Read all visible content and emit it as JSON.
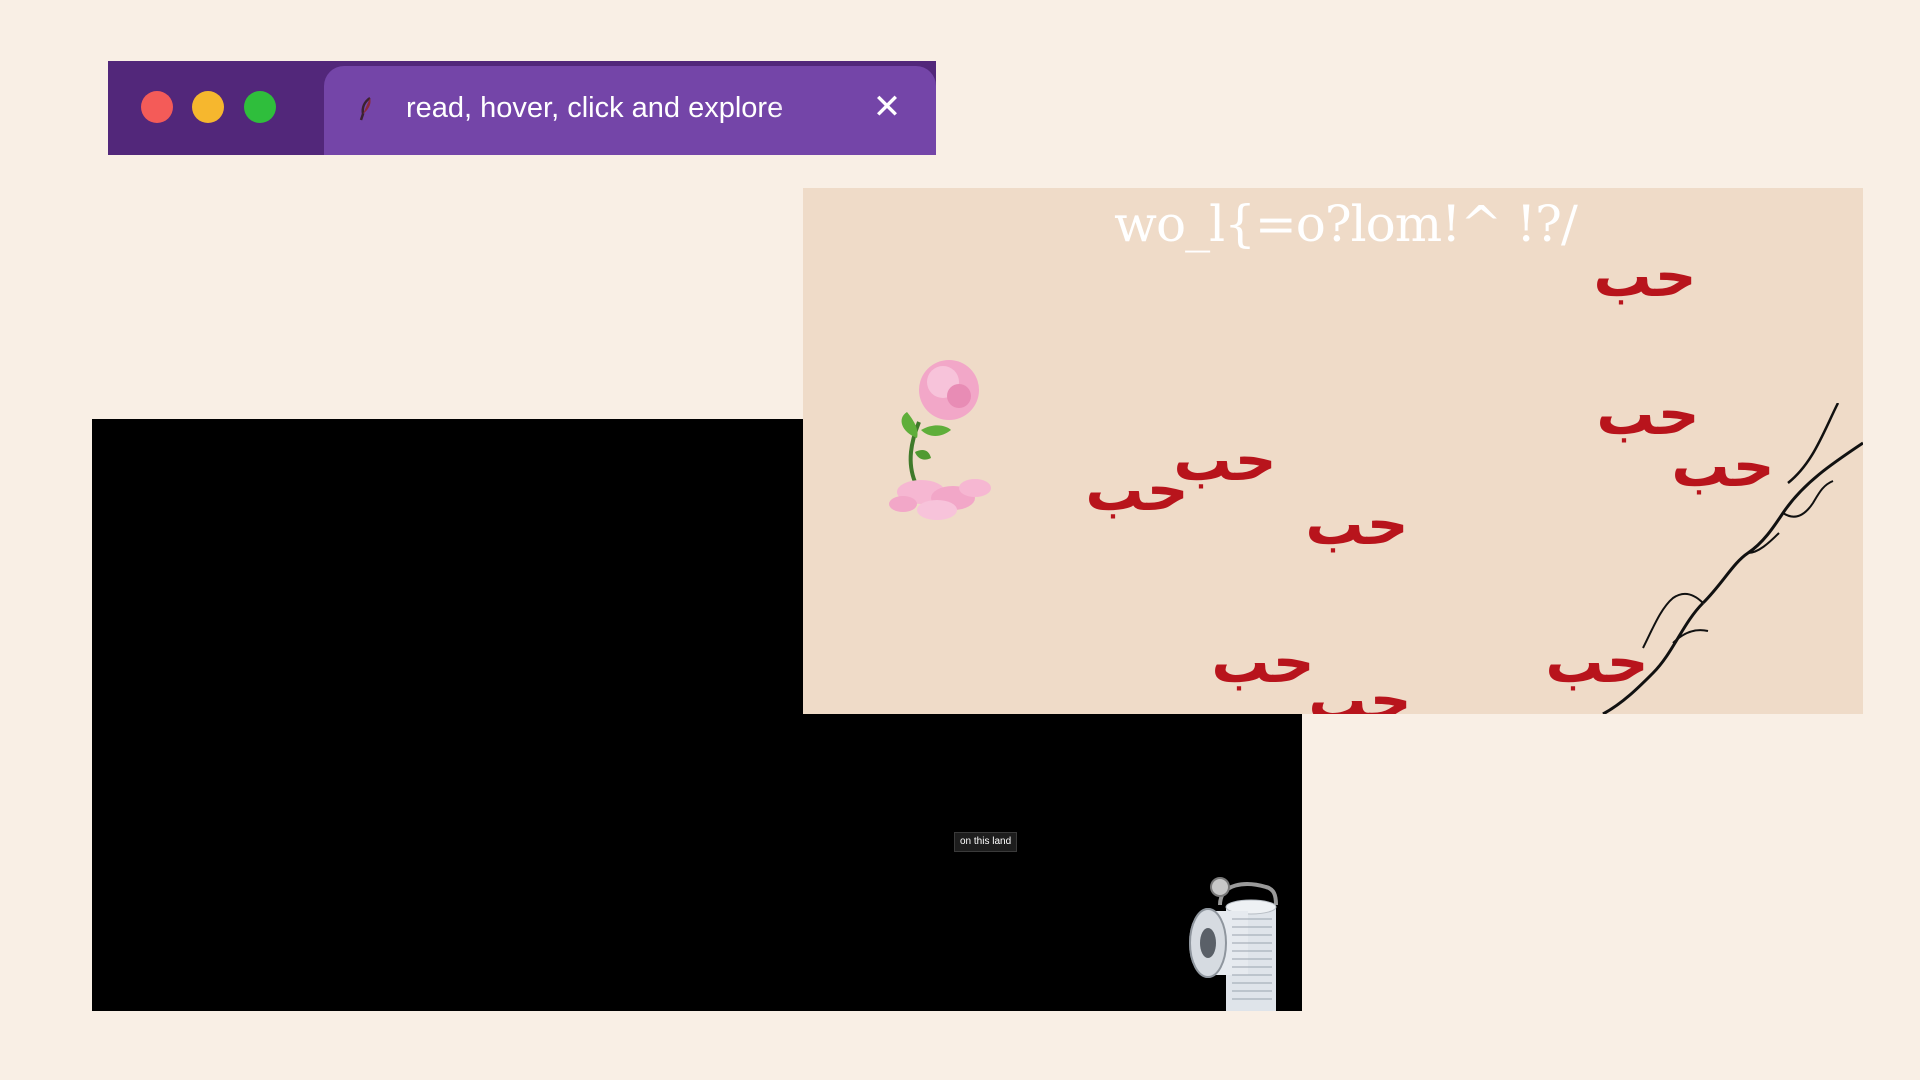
{
  "browser": {
    "tab": {
      "title": "read, hover, click and explore",
      "close_glyph": "✕",
      "favicon": "feather-icon"
    },
    "window_controls": [
      "close-dot",
      "minimize-dot",
      "maximize-dot"
    ],
    "colors": {
      "tabbar": "#52277a",
      "active_tab": "#7445a8",
      "close_dot": "#f45b58",
      "minimize_dot": "#f6b72e",
      "maximize_dot": "#2fbe3c"
    }
  },
  "video_window": {
    "caption": "on this land",
    "icon": "toilet-paper-roll-icon"
  },
  "art_panel": {
    "title": "wo_l{=o?lom!^ !?/",
    "calligraphy_glyph": "حب",
    "decorations": [
      "rose-icon",
      "reaching-hands-icon"
    ],
    "colors": {
      "background": "#efdbc8",
      "calligraphy": "#b8141c"
    }
  }
}
